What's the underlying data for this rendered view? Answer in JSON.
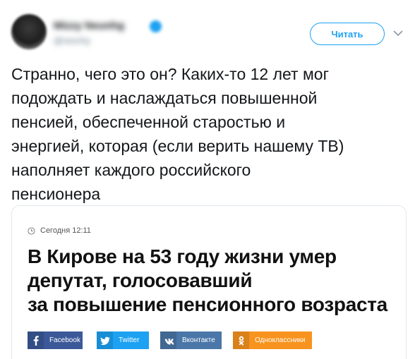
{
  "header": {
    "user_name": "Mizzy Neunhg",
    "user_handle": "@nevrhy",
    "follow_label": "Читать"
  },
  "tweet": {
    "text": "Странно, чего это он? Каких-то 12 лет мог\nподождать и наслаждаться повышенной\nпенсией, обеспеченной старостью и\nэнергией, которая (если верить нашему ТВ)\nнаполняет каждого российского\nпенсионера"
  },
  "card": {
    "time": "Сегодня 12:11",
    "title": "В Кирове на 53 году жизни умер\nдепутат, голосовавший\nза повышение пенсионного возраста",
    "share": [
      {
        "label": "Facebook",
        "icon": "facebook-icon",
        "color": "#3b5998",
        "glyph": "f"
      },
      {
        "label": "Twitter",
        "icon": "twitter-icon",
        "color": "#1da1f2",
        "glyph": "🐦"
      },
      {
        "label": "Вконтакте",
        "icon": "vk-icon",
        "color": "#4a76a8",
        "glyph": "vk"
      },
      {
        "label": "Одноклассники",
        "icon": "odnoklassniki-icon",
        "color": "#f7931e",
        "glyph": "ok"
      }
    ]
  },
  "colors": {
    "accent": "#1da1f2",
    "text": "#14171a",
    "border": "#e1e8ed"
  }
}
